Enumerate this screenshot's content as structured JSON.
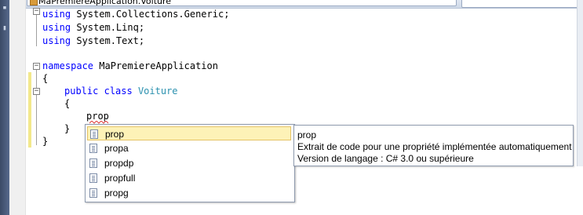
{
  "title_bar": {
    "dropdown_text": "MaPremiereApplication.Voiture"
  },
  "code": {
    "using_keyword": "using",
    "lines": [
      {
        "ns": " System.Collections.Generic;"
      },
      {
        "ns": " System.Linq;"
      },
      {
        "ns": " System.Text;"
      }
    ],
    "namespace_keyword": "namespace",
    "namespace_name": " MaPremiereApplication",
    "open_brace": "{",
    "class_modifier": "public",
    "class_keyword": "class",
    "class_name": "Voiture",
    "class_open_brace": "{",
    "typed_text": "prop",
    "class_close_brace": "}",
    "close_brace": "}"
  },
  "completion": {
    "items": [
      {
        "label": "prop"
      },
      {
        "label": "propa"
      },
      {
        "label": "propdp"
      },
      {
        "label": "propfull"
      },
      {
        "label": "propg"
      }
    ],
    "selected_index": 0
  },
  "tooltip": {
    "title": "prop",
    "description": "Extrait de code pour une propriété implémentée automatiquement",
    "version": "Version de langage : C# 3.0 ou supérieure"
  },
  "colors": {
    "keyword": "#0000ff",
    "type": "#2b91af",
    "selection": "#fdf2b7",
    "change_marker": "#f2e88b"
  }
}
